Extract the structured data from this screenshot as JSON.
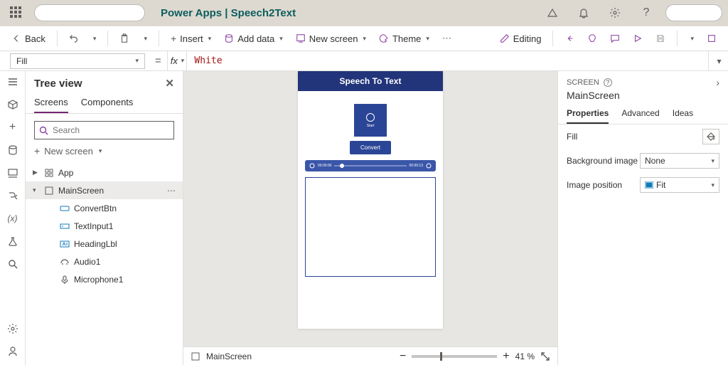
{
  "brand": {
    "title": "Power Apps  |  Speech2Text"
  },
  "cmd": {
    "back": "Back",
    "insert": "Insert",
    "add_data": "Add data",
    "new_screen": "New screen",
    "theme": "Theme",
    "editing": "Editing"
  },
  "formula": {
    "property": "Fill",
    "eq": "=",
    "fx": "fx",
    "value": "White"
  },
  "tree": {
    "title": "Tree view",
    "tabs": {
      "screens": "Screens",
      "components": "Components"
    },
    "search_placeholder": "Search",
    "new_screen": "New screen",
    "nodes": {
      "app": "App",
      "main": "MainScreen",
      "convert": "ConvertBtn",
      "textinput": "TextInput1",
      "heading": "HeadingLbl",
      "audio": "Audio1",
      "mic": "Microphone1"
    }
  },
  "preview": {
    "header": "Speech To Text",
    "mic_label": "Start",
    "convert": "Convert",
    "time_l": "00:00:00",
    "time_r": "00:00:13"
  },
  "canvas_footer": {
    "screen": "MainScreen",
    "zoom": "41  %"
  },
  "props": {
    "label": "SCREEN",
    "title": "MainScreen",
    "tabs": {
      "p": "Properties",
      "a": "Advanced",
      "i": "Ideas"
    },
    "fill": "Fill",
    "bgimg": "Background image",
    "bgimg_val": "None",
    "imgpos": "Image position",
    "imgpos_val": "Fit"
  }
}
